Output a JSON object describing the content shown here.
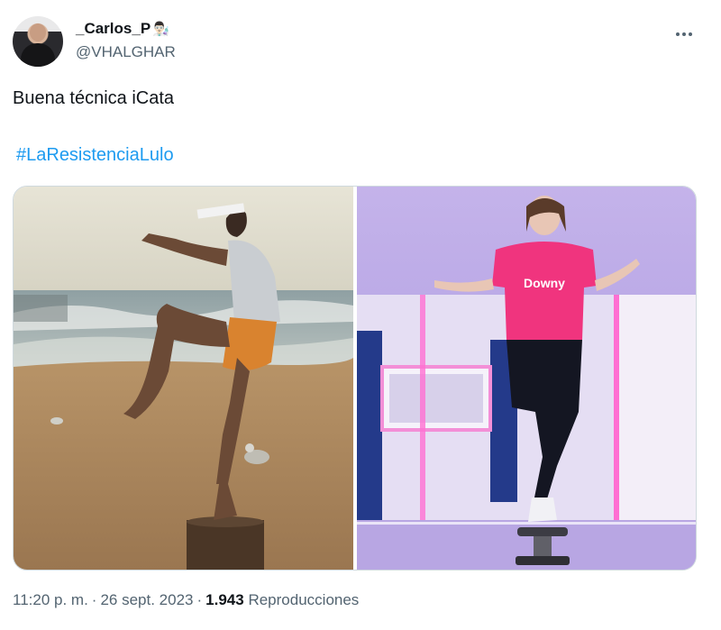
{
  "author": {
    "display_name": "_Carlos_P",
    "name_emoji": "👨🏻‍🔬",
    "handle": "@VHALGHAR"
  },
  "tweet": {
    "text": "Buena técnica iCata",
    "hashtag": "#LaResistenciaLulo"
  },
  "meta": {
    "time": "11:20 p. m.",
    "date": "26 sept. 2023",
    "views": "1.943",
    "views_label": "Reproducciones",
    "separator": "·"
  },
  "media": {
    "right_shirt_text": "Downy"
  },
  "icons": {
    "more": "more-horizontal-icon"
  }
}
